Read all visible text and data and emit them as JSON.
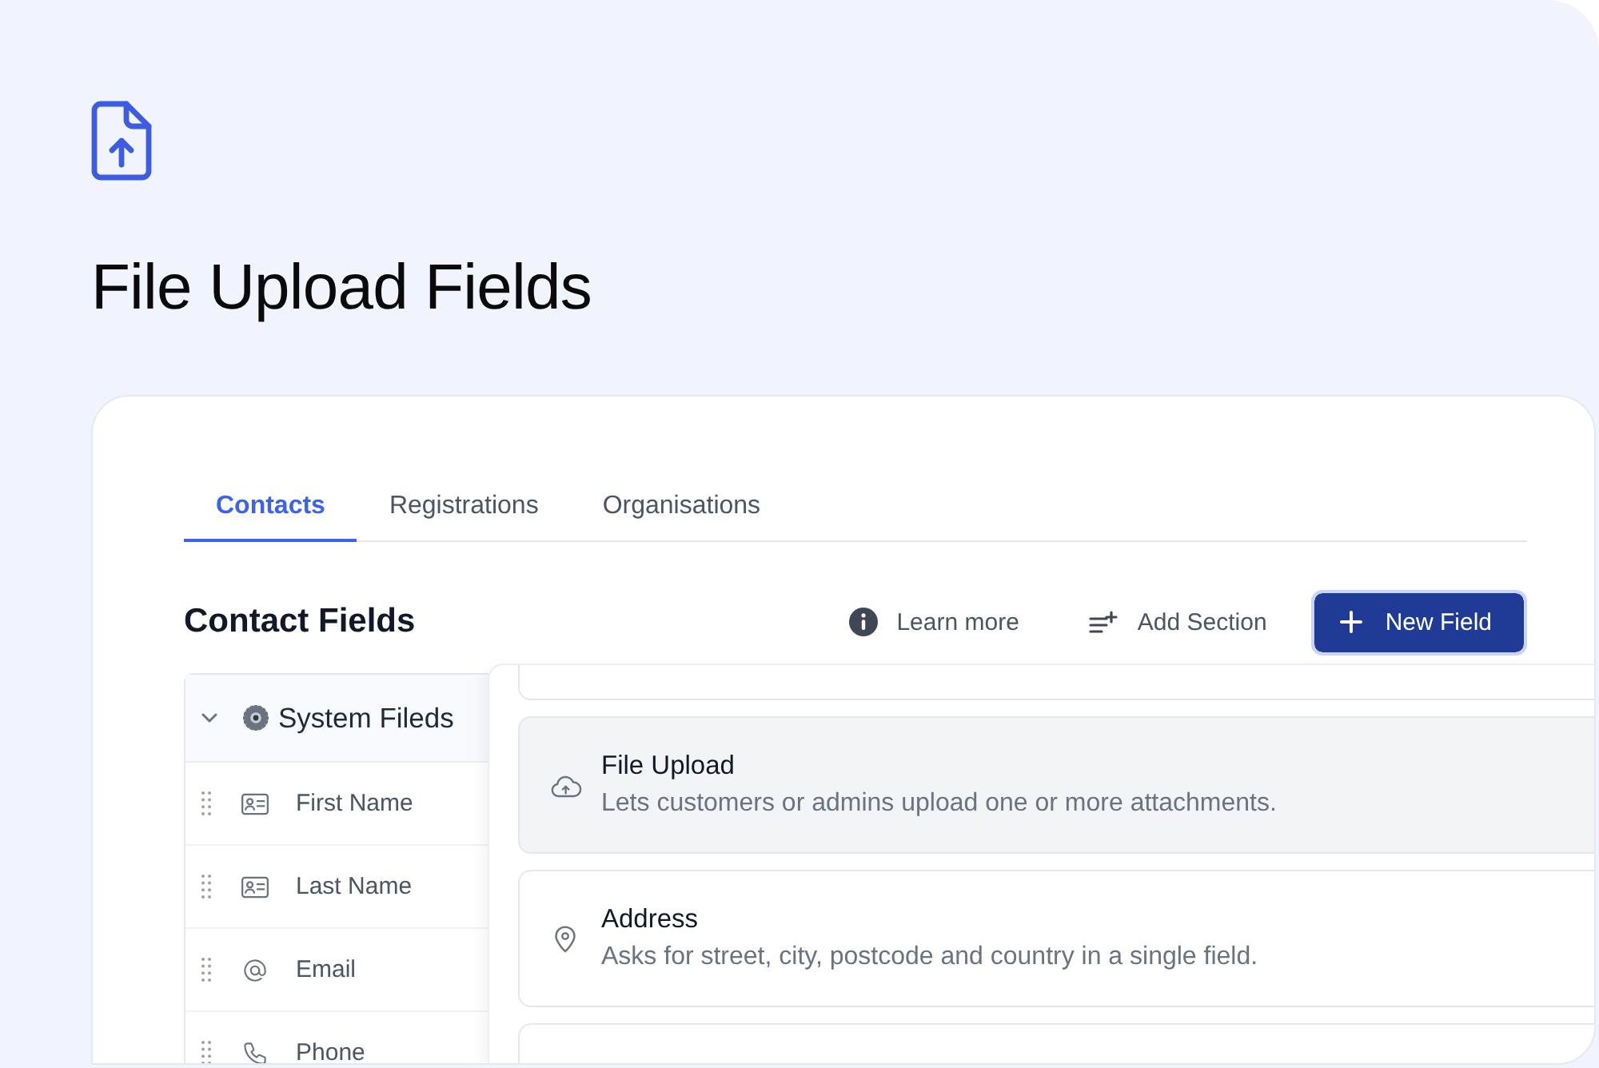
{
  "header": {
    "title": "File Upload Fields"
  },
  "tabs": [
    {
      "label": "Contacts",
      "selected": true
    },
    {
      "label": "Registrations",
      "selected": false
    },
    {
      "label": "Organisations",
      "selected": false
    }
  ],
  "section": {
    "title": "Contact Fields",
    "actions": [
      {
        "kind": "info",
        "label": "Learn more"
      },
      {
        "kind": "add-section",
        "label": "Add Section"
      },
      {
        "kind": "primary",
        "label": "New Field"
      }
    ]
  },
  "field_groups": [
    {
      "title": "System Fileds",
      "expanded": true,
      "children": [
        {
          "label": "First Name",
          "kind": "name"
        },
        {
          "label": "Last Name",
          "kind": "name"
        },
        {
          "label": "Email",
          "kind": "email"
        },
        {
          "label": "Phone",
          "kind": "phone"
        }
      ]
    }
  ],
  "field_types": [
    {
      "title": "File Upload",
      "description": "Lets customers or admins upload one or more attachments.",
      "kind": "upload",
      "selected": true
    },
    {
      "title": "Address",
      "description": "Asks for street, city, postcode and country in a single field.",
      "kind": "address",
      "selected": false
    }
  ]
}
